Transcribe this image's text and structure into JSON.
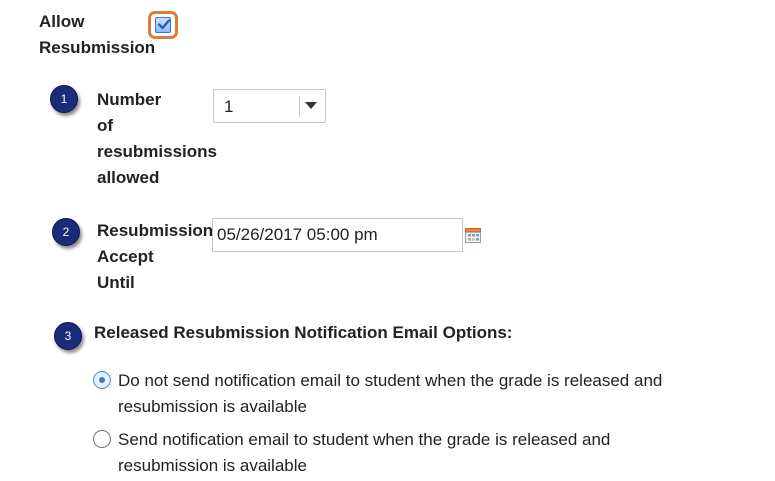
{
  "allow_resubmission": {
    "label": "Allow Resubmission",
    "checked": true,
    "highlight_color": "#e07b3a"
  },
  "steps": [
    "1",
    "2",
    "3"
  ],
  "num_resubmissions": {
    "label_line1": "Number",
    "label_line2": "of",
    "label_line3": "resubmissions",
    "label_line4": "allowed",
    "value": "1"
  },
  "accept_until": {
    "label_line1": "Resubmission",
    "label_line2": "Accept",
    "label_line3": "Until",
    "value": "05/26/2017 05:00 pm",
    "icon": "calendar-icon"
  },
  "notification": {
    "heading": "Released Resubmission Notification Email Options:",
    "options": [
      {
        "line1": "Do not send notification email to student when the grade is released and",
        "line2": "resubmission is available",
        "selected": true
      },
      {
        "line1": "Send notification email to student when the grade is released and",
        "line2": "resubmission is available",
        "selected": false
      }
    ]
  },
  "colors": {
    "badge": "#1c2a7a",
    "radio_selected": "#3a79c9"
  }
}
